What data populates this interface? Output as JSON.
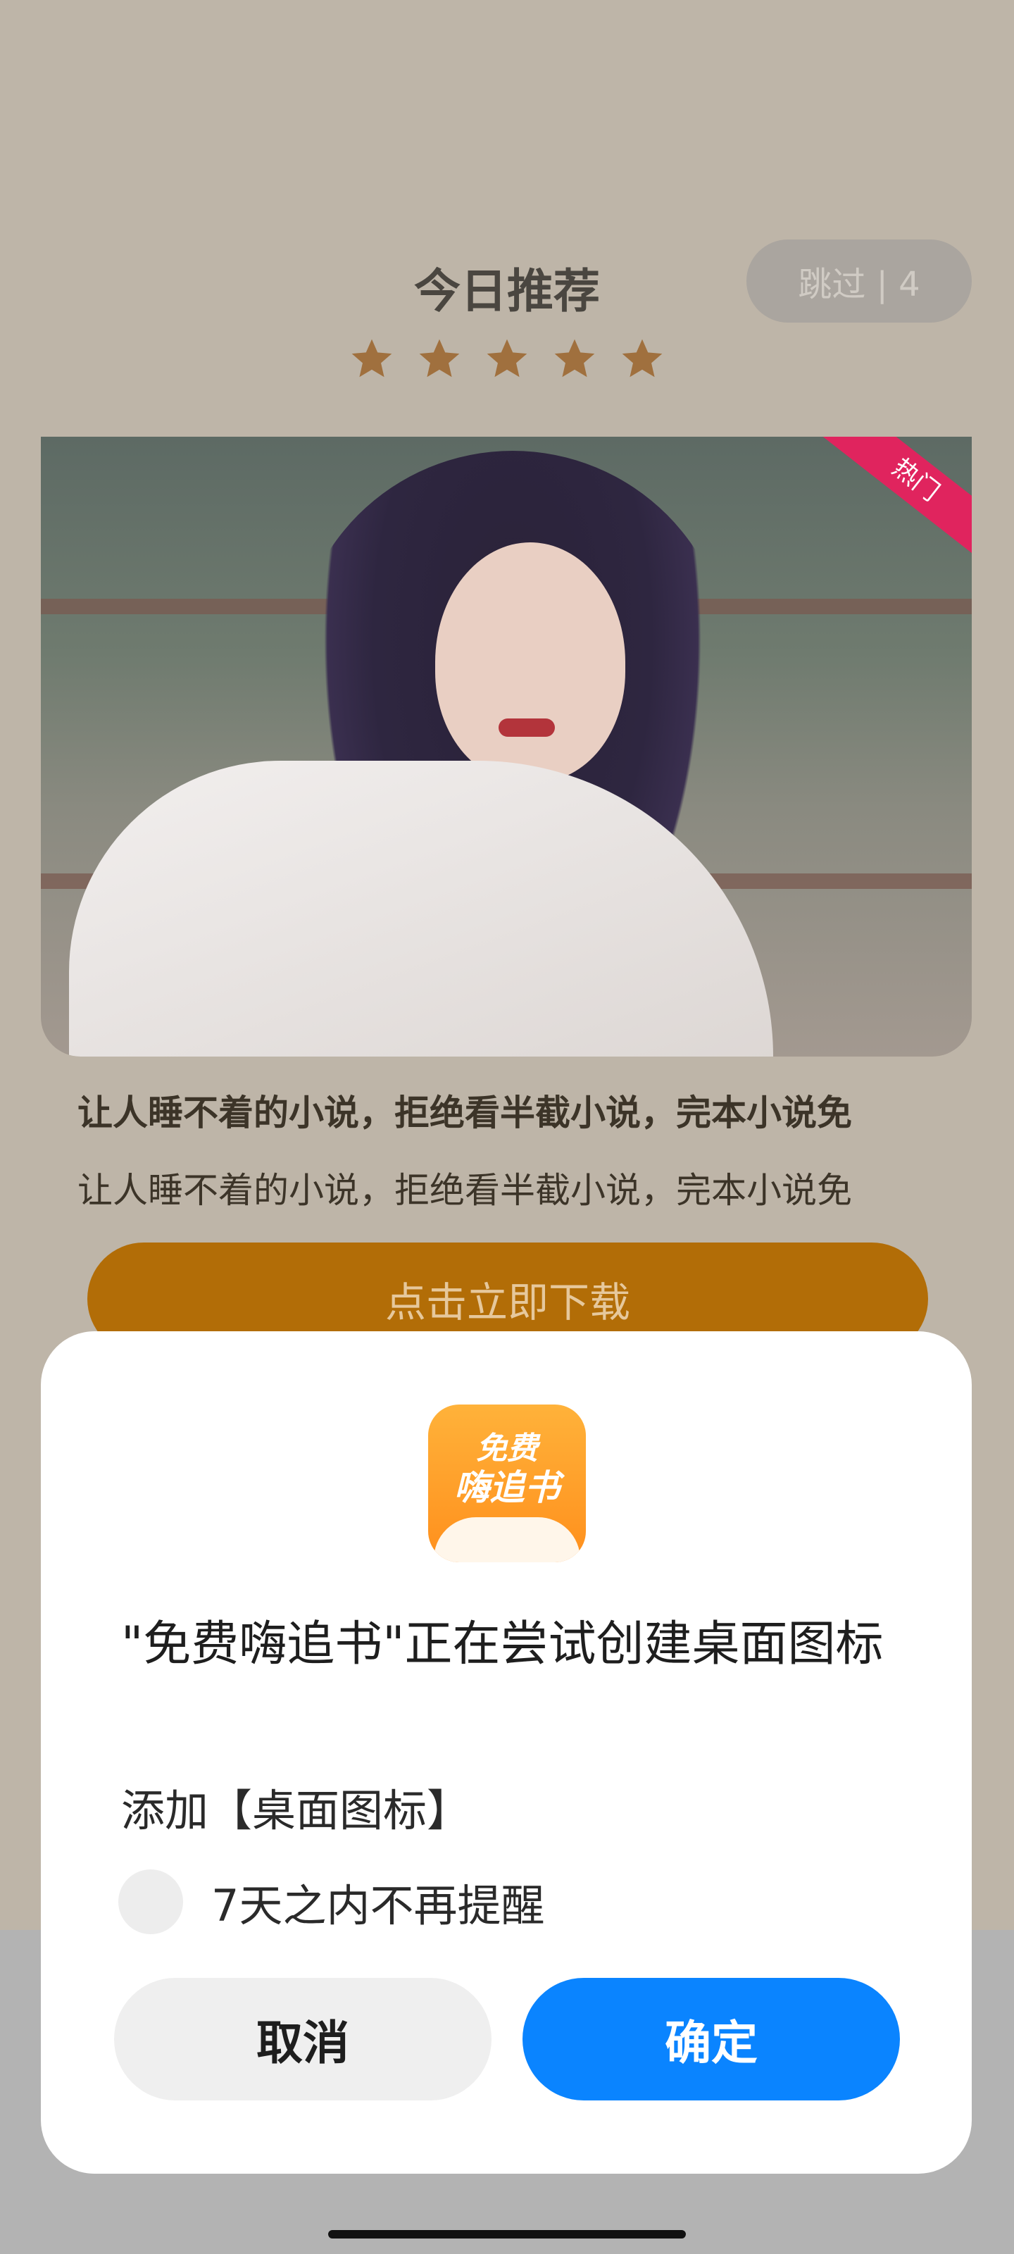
{
  "background": {
    "title": "今日推荐",
    "skip_label": "跳过 | 4",
    "stars": 5,
    "hot_badge": "热门",
    "promo_line_bold": "让人睡不着的小说，拒绝看半截小说，完本小说免",
    "promo_line": "让人睡不着的小说，拒绝看半截小说，完本小说免",
    "download_label": "点击立即下载"
  },
  "dialog": {
    "app_icon_line1": "免费",
    "app_icon_line2": "嗨追书",
    "title": "\"免费嗨追书\"正在尝试创建桌面图标",
    "subtitle": "添加【桌面图标】",
    "checkbox_label": "7天之内不再提醒",
    "checkbox_checked": false,
    "cancel_label": "取消",
    "ok_label": "确定"
  },
  "colors": {
    "star": "#a0703e",
    "download_button": "#b26d07",
    "ok_button": "#0a84ff",
    "hot_badge": "#e0245e"
  }
}
